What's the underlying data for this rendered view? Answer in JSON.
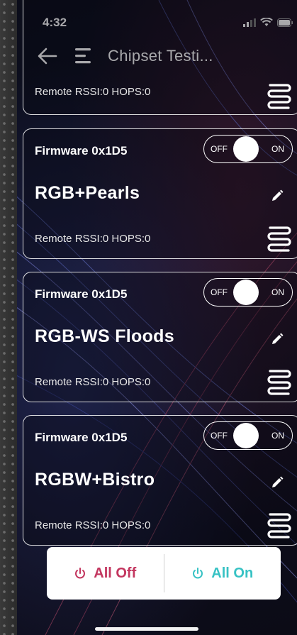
{
  "status_bar": {
    "time": "4:32"
  },
  "header": {
    "title": "Chipset Testi..."
  },
  "top_card": {
    "rssi_text": "Remote RSSI:0 HOPS:0"
  },
  "devices": [
    {
      "firmware": "Firmware 0x1D5",
      "name": "RGB+Pearls",
      "toggle_off": "OFF",
      "toggle_on": "ON",
      "rssi_text": "Remote RSSI:0 HOPS:0"
    },
    {
      "firmware": "Firmware 0x1D5",
      "name": "RGB-WS Floods",
      "toggle_off": "OFF",
      "toggle_on": "ON",
      "rssi_text": "Remote RSSI:0 HOPS:0"
    },
    {
      "firmware": "Firmware 0x1D5",
      "name": "RGBW+Bistro",
      "toggle_off": "OFF",
      "toggle_on": "ON",
      "rssi_text": "Remote RSSI:0 HOPS:0"
    }
  ],
  "actions": {
    "all_off": "All Off",
    "all_on": "All On"
  },
  "colors": {
    "off_accent": "#c3365f",
    "on_accent": "#37c2c4"
  },
  "icons": [
    "back-arrow-icon",
    "menu-icon",
    "edit-pencil-icon",
    "spring-icon",
    "power-icon",
    "signal-icon",
    "wifi-icon",
    "battery-icon"
  ]
}
